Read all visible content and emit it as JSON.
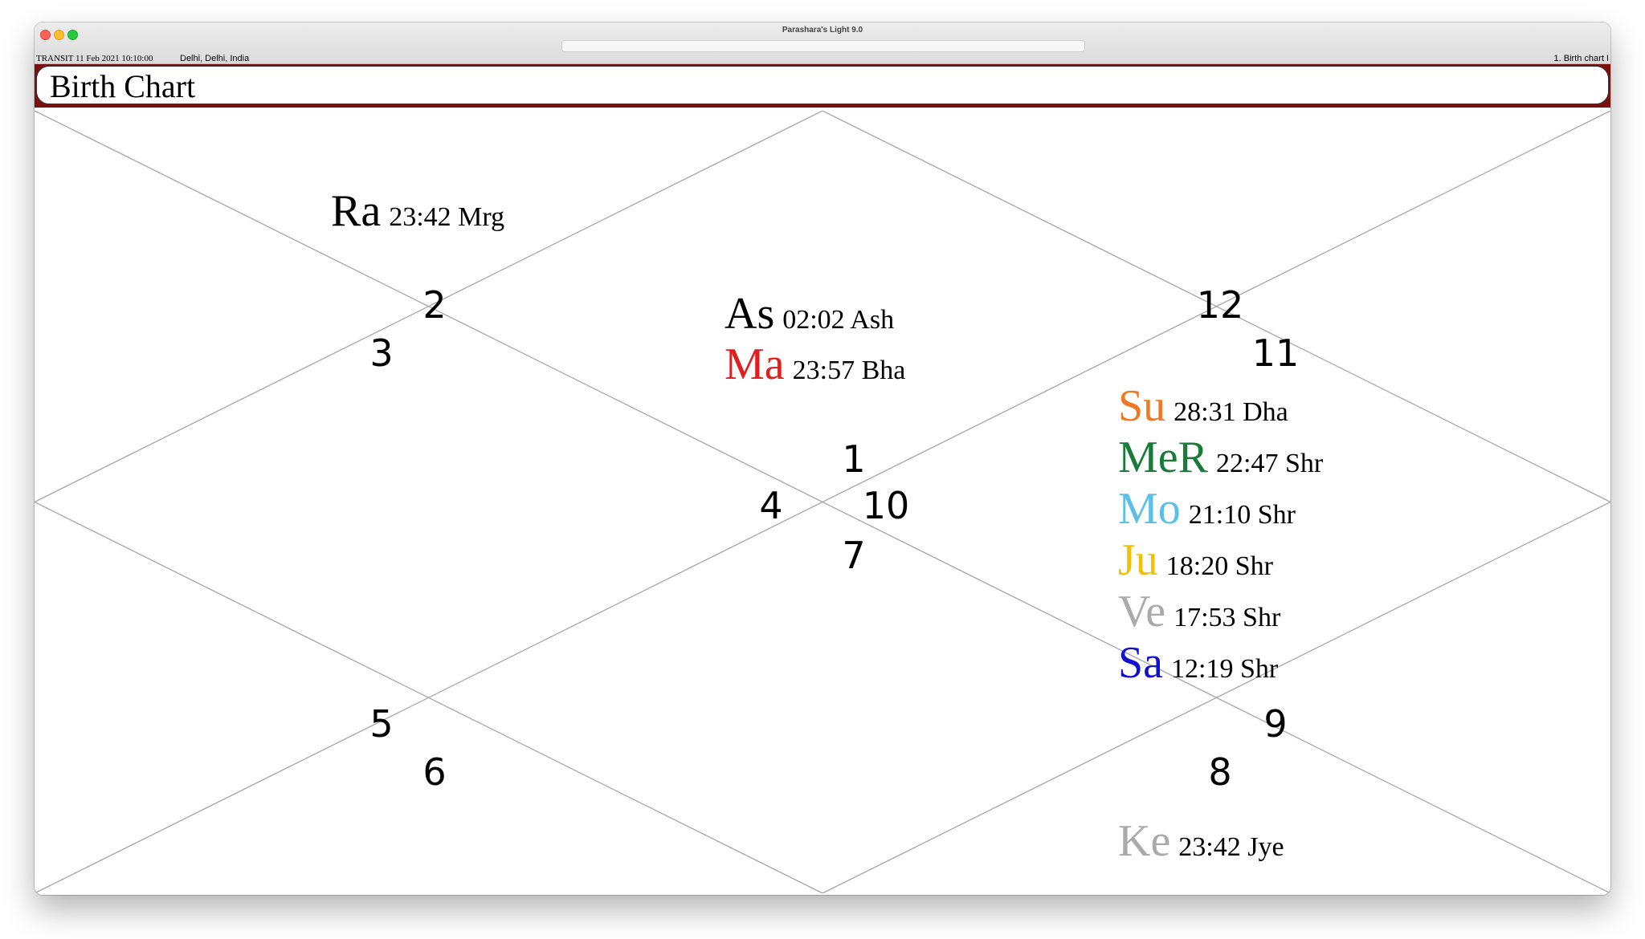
{
  "window": {
    "title": "Parashara's Light 9.0"
  },
  "info_bar": {
    "transit": "TRANSIT  11 Feb 2021  10:10:00",
    "location": "Delhi, Delhi, India",
    "tab": "1. Birth chart I"
  },
  "chart": {
    "title": "Birth Chart",
    "houses": [
      "1",
      "2",
      "3",
      "4",
      "5",
      "6",
      "7",
      "8",
      "9",
      "10",
      "11",
      "12"
    ],
    "planets": [
      {
        "abbr": "Ra",
        "deg": "23:42 Mrg",
        "color": "#000000"
      },
      {
        "abbr": "As",
        "deg": "02:02 Ash",
        "color": "#000000"
      },
      {
        "abbr": "Ma",
        "deg": "23:57 Bha",
        "color": "#e02020"
      },
      {
        "abbr": "Su",
        "deg": "28:31 Dha",
        "color": "#f07820"
      },
      {
        "abbr": "MeR",
        "deg": "22:47 Shr",
        "color": "#1a7a3a"
      },
      {
        "abbr": "Mo",
        "deg": "21:10 Shr",
        "color": "#5bbfe8"
      },
      {
        "abbr": "Ju",
        "deg": "18:20 Shr",
        "color": "#f2c200"
      },
      {
        "abbr": "Ve",
        "deg": "17:53 Shr",
        "color": "#aaaaaa"
      },
      {
        "abbr": "Sa",
        "deg": "12:19 Shr",
        "color": "#1010d0"
      },
      {
        "abbr": "Ke",
        "deg": "23:42 Jye",
        "color": "#aaaaaa"
      }
    ]
  }
}
